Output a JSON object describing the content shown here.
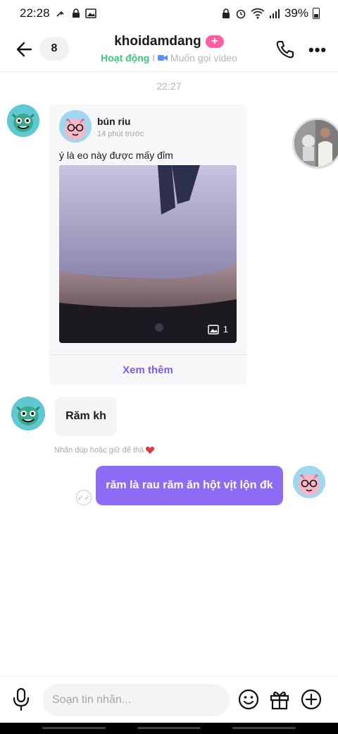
{
  "status": {
    "time": "22:28",
    "battery": "39%"
  },
  "header": {
    "back_icon": "arrow-left-icon",
    "unread_count": "8",
    "title": "khoidamdang",
    "plus_badge": "+",
    "status_active": "Hoạt động",
    "status_sep": " I ",
    "status_video": "Muốn gọi video",
    "accent_color": "#38c976"
  },
  "timestamp": "22:27",
  "shared_post": {
    "author": "bún riu",
    "time_ago": "14 phút trước",
    "caption": "ý là eo này được mấy đỉm",
    "photo_count": "1",
    "more_label": "Xem thêm",
    "link_color": "#7a5cf0"
  },
  "messages": {
    "incoming": "Răm kh",
    "hint": "Nhấn đúp hoặc giữ để thả",
    "outgoing": "răm là rau răm ăn hột vịt lộn đk",
    "bubble_color": "#8c6cf4"
  },
  "composer": {
    "placeholder": "Soạn tin nhắn..."
  }
}
